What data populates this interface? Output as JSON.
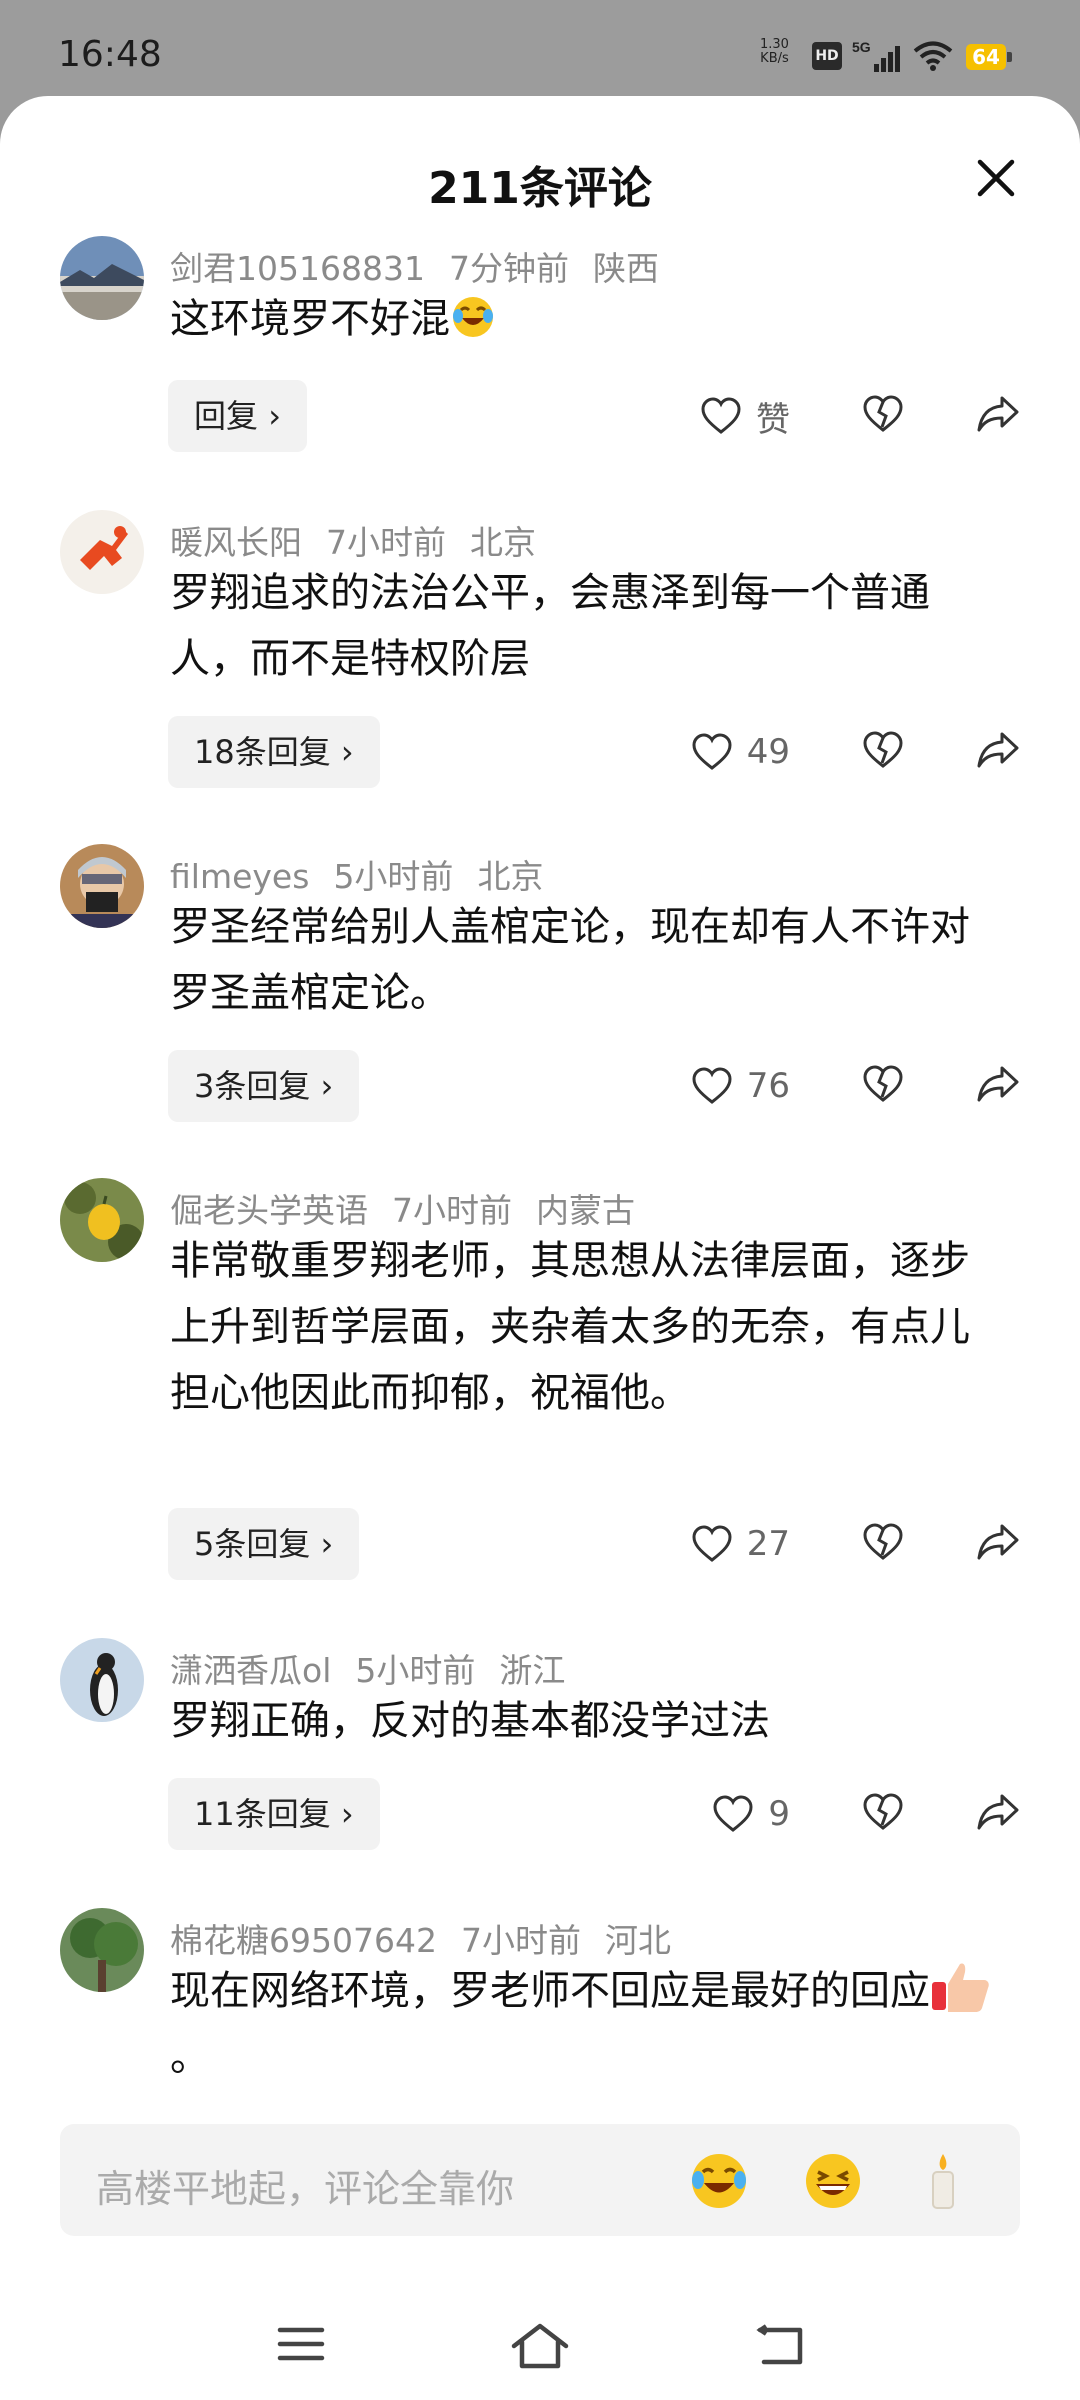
{
  "status_bar": {
    "time": "16:48",
    "net_speed": "1.30",
    "net_unit": "KB/s",
    "hd": "HD",
    "signal": "5G",
    "battery": "64"
  },
  "header": {
    "title": "211条评论"
  },
  "comments": [
    {
      "user": "剑君105168831",
      "time": "7分钟前",
      "location": "陕西",
      "text": "这环境罗不好混",
      "reply_label": "回复",
      "like_label": "赞"
    },
    {
      "user": "暖风长阳",
      "time": "7小时前",
      "location": "北京",
      "text": "罗翔追求的法治公平，会惠泽到每一个普通人，而不是特权阶层",
      "reply_label": "18条回复",
      "like_label": "49"
    },
    {
      "user": "filmeyes",
      "time": "5小时前",
      "location": "北京",
      "text": "罗圣经常给别人盖棺定论，现在却有人不许对罗圣盖棺定论。",
      "reply_label": "3条回复",
      "like_label": "76"
    },
    {
      "user": "倔老头学英语",
      "time": "7小时前",
      "location": "内蒙古",
      "text": "非常敬重罗翔老师，其思想从法律层面，逐步上升到哲学层面，夹杂着太多的无奈，有点儿担心他因此而抑郁，祝福他。",
      "reply_label": "5条回复",
      "like_label": "27"
    },
    {
      "user": "潇洒香瓜ol",
      "time": "5小时前",
      "location": "浙江",
      "text": "罗翔正确，反对的基本都没学过法",
      "reply_label": "11条回复",
      "like_label": "9"
    },
    {
      "user": "棉花糖69507642",
      "time": "7小时前",
      "location": "河北",
      "text": "现在网络环境，罗老师不回应是最好的回应",
      "text_suffix": "。"
    }
  ],
  "input": {
    "placeholder": "高楼平地起，评论全靠你"
  },
  "icons": {
    "close": "close-icon",
    "like": "heart-icon",
    "dislike": "broken-heart-icon",
    "share": "share-arrow-icon",
    "reply_chevron": "chevron-right-icon",
    "nav": [
      "menu-icon",
      "home-icon",
      "back-icon"
    ]
  },
  "colors": {
    "sheet_bg": "#ffffff",
    "meta_text": "#8a8a8a",
    "reply_bg": "#f2f2f2",
    "statusbar_bg": "#9c9c9c"
  }
}
